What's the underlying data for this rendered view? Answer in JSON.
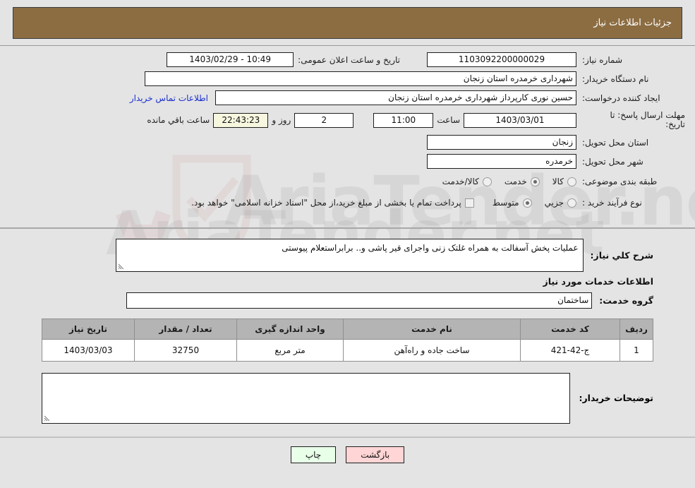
{
  "header": {
    "title": "جزئیات اطلاعات نیاز",
    "bar_color": "#8c6d42"
  },
  "form": {
    "need_number_label": "شماره نیاز:",
    "need_number_value": "1103092200000029",
    "announce_datetime_label": "تاریخ و ساعت اعلان عمومی:",
    "announce_datetime_value": "10:49 - 1403/02/29",
    "buyer_org_label": "نام دستگاه خریدار:",
    "buyer_org_value": "شهرداری خرمدره استان زنجان",
    "creator_label": "ایجاد کننده درخواست:",
    "creator_value": "حسین نوری کارپرداز شهرداری خرمدره استان زنجان",
    "contact_link": "اطلاعات تماس خریدار",
    "deadline_label_line1": "مهلت ارسال پاسخ: تا",
    "deadline_label_line2": "تاریخ:",
    "deadline_date_value": "1403/03/01",
    "hour_label": "ساعت",
    "hour_value": "11:00",
    "days_value": "2",
    "days_label": "روز و",
    "countdown_value": "22:43:23",
    "countdown_label": "ساعت باقي مانده",
    "province_label": "استان محل تحویل:",
    "province_value": "زنجان",
    "city_label": "شهر محل تحویل:",
    "city_value": "خرمدره",
    "category_label": "طبقه بندی موضوعی:",
    "category_options": [
      {
        "label": "کالا",
        "checked": false
      },
      {
        "label": "خدمت",
        "checked": true
      },
      {
        "label": "کالا/خدمت",
        "checked": false
      }
    ],
    "process_label": "نوع فرآیند خرید :",
    "process_options": [
      {
        "label": "جزيي",
        "checked": false
      },
      {
        "label": "متوسط",
        "checked": true
      }
    ],
    "treasury_note": "پرداخت تمام یا بخشی از مبلغ خرید،از محل \"اسناد خزانه اسلامی\" خواهد بود.",
    "treasury_checked": false
  },
  "description": {
    "label": "شرح کلي نیاز:",
    "value": "عملیات پخش آسفالت به همراه غلتک زنی  واجرای قیر پاشی و.. برابراستعلام پیوستی"
  },
  "services": {
    "section_heading": "اطلاعات خدمات مورد نیاز",
    "group_label": "گروه خدمت:",
    "group_value": "ساختمان",
    "columns": [
      "ردیف",
      "کد خدمت",
      "نام خدمت",
      "واحد اندازه گیری",
      "تعداد / مقدار",
      "تاریخ نیاز"
    ],
    "rows": [
      {
        "row_no": "1",
        "service_code": "ج-42-421",
        "service_name": "ساخت جاده و راه‌آهن",
        "unit": "متر مربع",
        "quantity": "32750",
        "need_date": "1403/03/03"
      }
    ]
  },
  "buyer_comments": {
    "label": "توضیحات خریدار:",
    "value": ""
  },
  "footer": {
    "back_label": "بازگشت",
    "print_label": "چاپ"
  },
  "watermark": {
    "text": "AriaTender.net"
  }
}
